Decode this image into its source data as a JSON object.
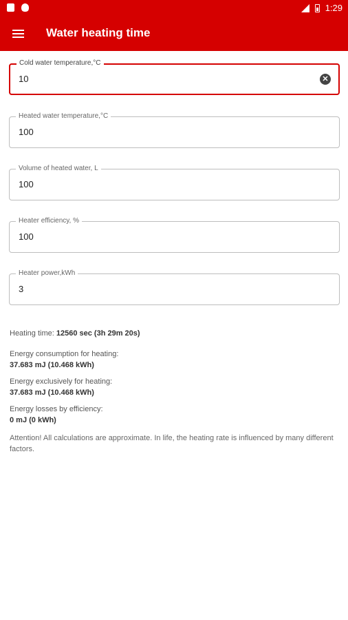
{
  "status_bar": {
    "time": "1:29"
  },
  "app_bar": {
    "title": "Water heating time"
  },
  "fields": [
    {
      "label": "Cold water temperature,°C",
      "value": "10"
    },
    {
      "label": "Heated water temperature,°C",
      "value": "100"
    },
    {
      "label": "Volume of heated water, L",
      "value": "100"
    },
    {
      "label": "Heater efficiency, %",
      "value": "100"
    },
    {
      "label": "Heater power,kWh",
      "value": "3"
    }
  ],
  "results": {
    "heating_time_label": "Heating time: ",
    "heating_time_value": "12560 sec (3h 29m 20s)",
    "energy_consumption_label": "Energy consumption for heating:",
    "energy_consumption_value": "37.683 mJ (10.468 kWh)",
    "energy_exclusive_label": "Energy exclusively for heating:",
    "energy_exclusive_value": "37.683 mJ (10.468 kWh)",
    "energy_losses_label": "Energy losses by efficiency:",
    "energy_losses_value": "0 mJ (0 kWh)",
    "attention": "Attention! All calculations are approximate. In life, the heating rate is influenced by many different factors."
  }
}
